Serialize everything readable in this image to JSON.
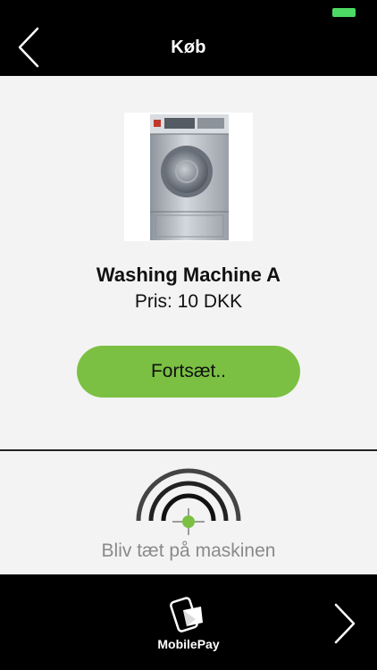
{
  "colors": {
    "accent_green": "#7bc043",
    "battery_green": "#4cd964",
    "panel_background": "#f3f3f3",
    "bar_background": "#000000",
    "muted_text": "#8a8a8a"
  },
  "status_bar": {
    "battery_icon": "battery-icon"
  },
  "nav": {
    "title": "Køb",
    "back_icon": "chevron-left-icon"
  },
  "product": {
    "image_icon": "washing-machine-image",
    "name": "Washing Machine A",
    "price": "Pris: 10 DKK",
    "continue_label": "Fortsæt.."
  },
  "proximity": {
    "icon": "signal-proximity-icon",
    "text": "Bliv tæt på maskinen"
  },
  "bottom_bar": {
    "payment_icon": "mobilepay-icon",
    "payment_label": "MobilePay",
    "next_icon": "chevron-right-icon"
  }
}
